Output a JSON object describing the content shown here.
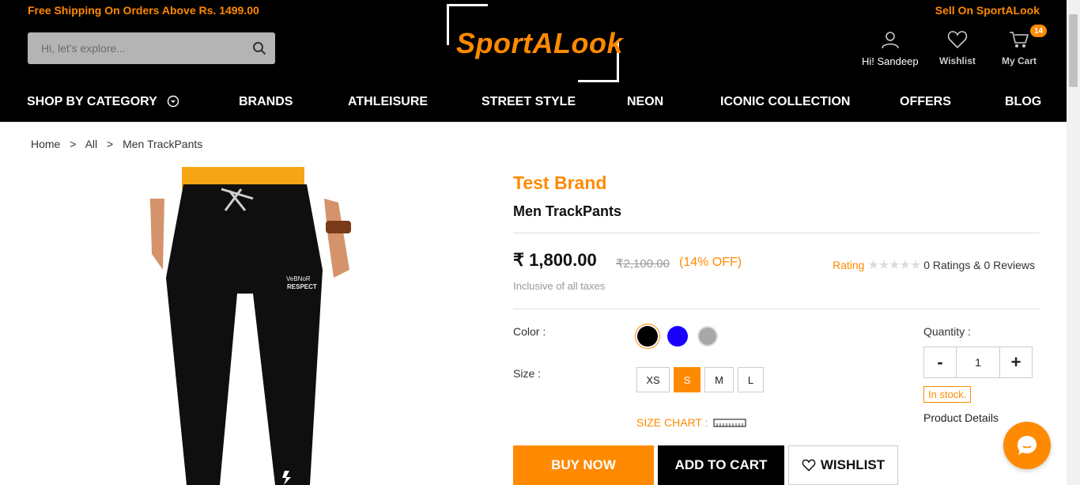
{
  "header": {
    "promo": "Free Shipping On Orders Above Rs. 1499.00",
    "sell_link": "Sell On SportALook",
    "search_placeholder": "Hi, let's explore...",
    "logo_text": "SportALook",
    "user_label": "Hi! Sandeep",
    "wishlist_label": "Wishlist",
    "cart_label": "My Cart",
    "cart_count": "14"
  },
  "nav": {
    "items": [
      "SHOP BY CATEGORY",
      "BRANDS",
      "ATHLEISURE",
      "STREET STYLE",
      "NEON",
      "ICONIC COLLECTION",
      "OFFERS",
      "BLOG"
    ]
  },
  "breadcrumb": {
    "items": [
      "Home",
      "All",
      "Men TrackPants"
    ],
    "separator": ">"
  },
  "product": {
    "brand": "Test Brand",
    "name": "Men TrackPants",
    "price": "₹ 1,800.00",
    "mrp": "₹2,100.00",
    "discount": "(14% OFF)",
    "tax_note": "Inclusive of all taxes",
    "rating_label": "Rating",
    "rating_stars": "★★★★★",
    "reviews": "0 Ratings & 0 Reviews",
    "image_text_1": "VeBNoR",
    "image_text_2": "RESPECT"
  },
  "options": {
    "color_label": "Color :",
    "colors": [
      "#000000",
      "#1a00ff",
      "#a8a8a8"
    ],
    "size_label": "Size :",
    "sizes": [
      "XS",
      "S",
      "M",
      "L"
    ],
    "selected_size": "S",
    "size_chart_label": "SIZE CHART :",
    "quantity_label": "Quantity :",
    "quantity_value": "1",
    "qty_minus": "-",
    "qty_plus": "+",
    "stock": "In stock.",
    "product_details": "Product Details"
  },
  "actions": {
    "buy_now": "BUY NOW",
    "add_to_cart": "ADD TO CART",
    "wishlist": "WISHLIST"
  },
  "colors": {
    "accent": "#ff8a00",
    "header_bg": "#000000"
  }
}
